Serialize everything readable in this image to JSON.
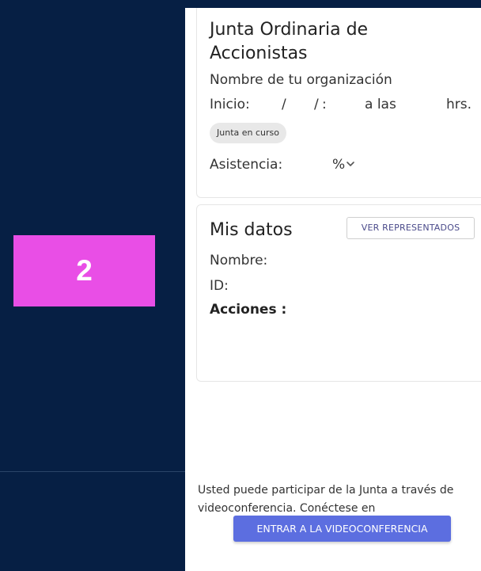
{
  "step_badge": "2",
  "meeting": {
    "title_line1": "Junta Ordinaria de",
    "title_line2": "Accionistas",
    "organization": "Nombre de tu organización",
    "start_label": "Inicio:",
    "slash": "/",
    "colon": ":",
    "at_label": "a las",
    "hrs_label": "hrs.",
    "status_chip": "Junta en curso",
    "attendance_label": "Asistencia:",
    "attendance_unit": "%"
  },
  "my_data": {
    "title": "Mis datos",
    "view_represented_button": "VER REPRESENTADOS",
    "name_label": "Nombre:",
    "id_label": "ID:",
    "shares_label": "Acciones :"
  },
  "video": {
    "note": "Usted puede participar de la Junta a través de videoconferencia. Conéctese en",
    "join_button": "ENTRAR A LA VIDEOCONFERENCIA"
  },
  "colors": {
    "background": "#061f44",
    "badge": "#e94ee6",
    "button": "#5c6ee0"
  },
  "icons": [
    "chevron-down-icon"
  ]
}
